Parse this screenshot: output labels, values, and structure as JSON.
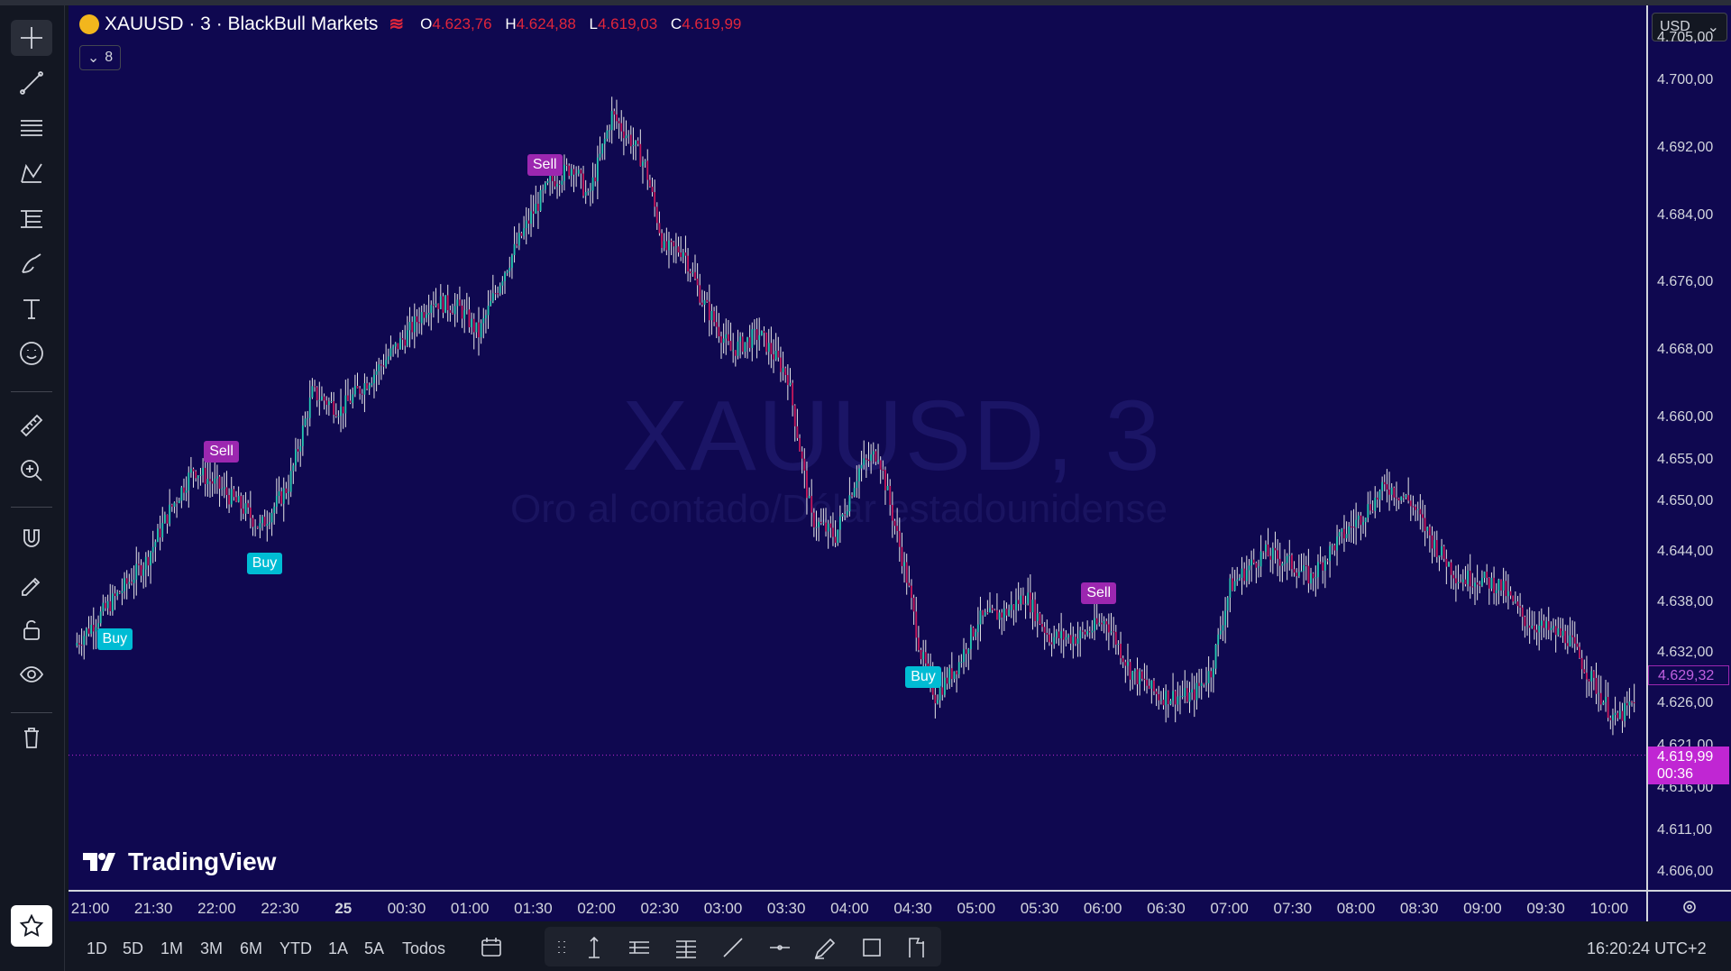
{
  "symbol": {
    "name": "XAUUSD",
    "interval": "3",
    "broker": "BlackBull Markets",
    "full_title": "XAUUSD · 3 · BlackBull Markets",
    "watermark_title": "XAUUSD, 3",
    "watermark_subtitle": "Oro al contado/Dólar estadounidense"
  },
  "ohlc": {
    "o_label": "O",
    "o": "4.623,76",
    "h_label": "H",
    "h": "4.624,88",
    "l_label": "L",
    "l": "4.619,03",
    "c_label": "C",
    "c": "4.619,99"
  },
  "indicators_count": "8",
  "currency": "USD",
  "brand": "TradingView",
  "colors": {
    "background": "#0f0850",
    "up": "#26c6b0",
    "down": "#c2185b",
    "buy": "#00bcd4",
    "sell": "#9c27b0",
    "accent": "#e0263b"
  },
  "price_axis": {
    "ticks": [
      "4.705,00",
      "4.700,00",
      "4.692,00",
      "4.684,00",
      "4.676,00",
      "4.668,00",
      "4.660,00",
      "4.655,00",
      "4.650,00",
      "4.644,00",
      "4.638,00",
      "4.632,00",
      "4.626,00",
      "4.621,00",
      "4.616,00",
      "4.611,00",
      "4.606,00"
    ],
    "tick_values": [
      4705,
      4700,
      4692,
      4684,
      4676,
      4668,
      4660,
      4655,
      4650,
      4644,
      4638,
      4632,
      4626,
      4621,
      4616,
      4611,
      4606
    ],
    "last_price_label": "4.619,99",
    "countdown": "00:36",
    "marker_price_label": "4.629,32",
    "marker_price": 4629.32,
    "last_price": 4619.99
  },
  "time_axis": {
    "ticks": [
      "21:00",
      "21:30",
      "22:00",
      "22:30",
      "25",
      "00:30",
      "01:00",
      "01:30",
      "02:00",
      "02:30",
      "03:00",
      "03:30",
      "04:00",
      "04:30",
      "05:00",
      "05:30",
      "06:00",
      "06:30",
      "07:00",
      "07:30",
      "08:00",
      "08:30",
      "09:00",
      "09:30",
      "10:00"
    ]
  },
  "signals": [
    {
      "label": "Buy",
      "type": "buy",
      "bar": 15
    },
    {
      "label": "Sell",
      "type": "sell",
      "bar": 60
    },
    {
      "label": "Buy",
      "type": "buy",
      "bar": 78
    },
    {
      "label": "Sell",
      "type": "sell",
      "bar": 196
    },
    {
      "label": "Buy",
      "type": "buy",
      "bar": 355
    },
    {
      "label": "Sell",
      "type": "sell",
      "bar": 429
    }
  ],
  "ranges": [
    "1D",
    "5D",
    "1M",
    "3M",
    "6M",
    "YTD",
    "1A",
    "5A",
    "Todos"
  ],
  "clock": "16:20:24 UTC+2",
  "chart_data": {
    "type": "candlestick",
    "y_range": [
      4604,
      4709
    ],
    "anchors": [
      [
        0,
        4633
      ],
      [
        15,
        4638
      ],
      [
        30,
        4643
      ],
      [
        40,
        4649
      ],
      [
        50,
        4654
      ],
      [
        60,
        4652
      ],
      [
        72,
        4649
      ],
      [
        78,
        4647
      ],
      [
        90,
        4652
      ],
      [
        100,
        4663
      ],
      [
        112,
        4661
      ],
      [
        125,
        4665
      ],
      [
        140,
        4670
      ],
      [
        150,
        4674
      ],
      [
        162,
        4673
      ],
      [
        170,
        4670
      ],
      [
        180,
        4677
      ],
      [
        192,
        4684
      ],
      [
        200,
        4688
      ],
      [
        210,
        4690
      ],
      [
        216,
        4686
      ],
      [
        226,
        4696
      ],
      [
        234,
        4693
      ],
      [
        240,
        4690
      ],
      [
        248,
        4680
      ],
      [
        256,
        4680
      ],
      [
        264,
        4674
      ],
      [
        276,
        4668
      ],
      [
        288,
        4670
      ],
      [
        300,
        4665
      ],
      [
        310,
        4648
      ],
      [
        320,
        4646
      ],
      [
        330,
        4654
      ],
      [
        338,
        4656
      ],
      [
        350,
        4641
      ],
      [
        356,
        4632
      ],
      [
        362,
        4627
      ],
      [
        372,
        4631
      ],
      [
        380,
        4636
      ],
      [
        392,
        4637
      ],
      [
        400,
        4639
      ],
      [
        410,
        4634
      ],
      [
        422,
        4634
      ],
      [
        434,
        4636
      ],
      [
        444,
        4630
      ],
      [
        456,
        4627
      ],
      [
        470,
        4627
      ],
      [
        478,
        4630
      ],
      [
        486,
        4640
      ],
      [
        500,
        4644
      ],
      [
        510,
        4643
      ],
      [
        520,
        4641
      ],
      [
        530,
        4645
      ],
      [
        540,
        4648
      ],
      [
        552,
        4652
      ],
      [
        562,
        4650
      ],
      [
        572,
        4645
      ],
      [
        582,
        4641
      ],
      [
        590,
        4641
      ],
      [
        600,
        4640
      ],
      [
        610,
        4636
      ],
      [
        618,
        4635
      ],
      [
        628,
        4634
      ],
      [
        636,
        4630
      ],
      [
        648,
        4624
      ],
      [
        655,
        4626
      ]
    ]
  }
}
